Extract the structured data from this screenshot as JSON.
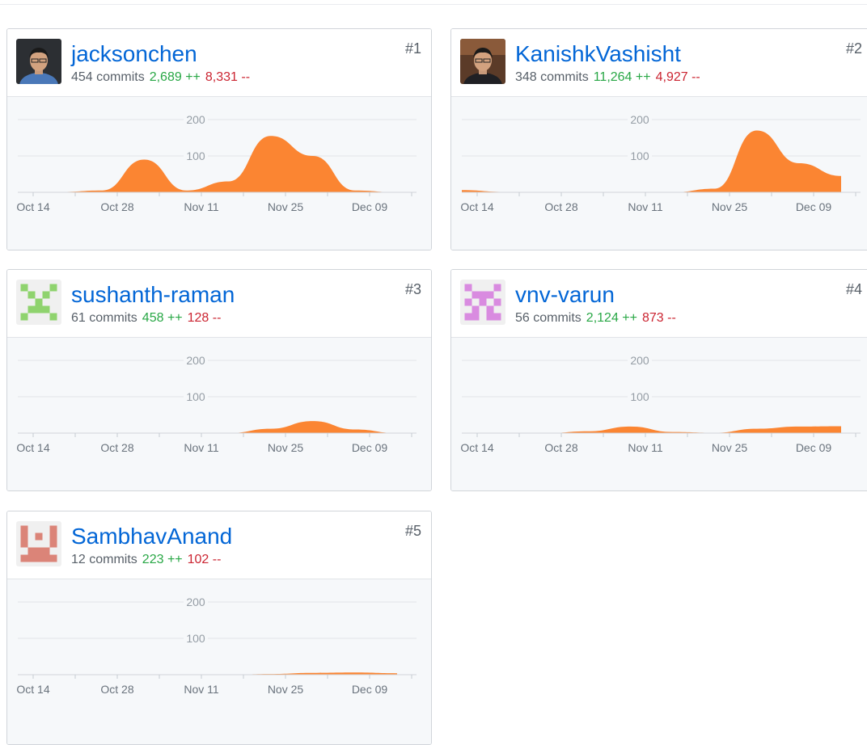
{
  "contributors": [
    {
      "username": "jacksonchen",
      "rank": "#1",
      "commits": "454 commits",
      "additions": "2,689 ++",
      "deletions": "8,331 --",
      "avatar": {
        "type": "photo",
        "icon": "person-photo"
      },
      "chart_data": {
        "type": "area",
        "x": [
          "Oct 14",
          "Oct 21",
          "Oct 28",
          "Nov 04",
          "Nov 11",
          "Nov 18",
          "Nov 25",
          "Dec 02",
          "Dec 09",
          "Dec 13"
        ],
        "values": [
          0,
          1,
          5,
          90,
          5,
          30,
          155,
          100,
          5,
          0
        ],
        "ylim": [
          0,
          200
        ],
        "y_ticks": [
          "100",
          "200"
        ],
        "tick_labels": [
          "Oct 14",
          "Oct 28",
          "Nov 11",
          "Nov 25",
          "Dec 09"
        ],
        "color": "#fb8532"
      }
    },
    {
      "username": "KanishkVashisht",
      "rank": "#2",
      "commits": "348 commits",
      "additions": "11,264 ++",
      "deletions": "4,927 --",
      "avatar": {
        "type": "photo",
        "icon": "person-photo"
      },
      "chart_data": {
        "type": "area",
        "x": [
          "Oct 14",
          "Oct 21",
          "Oct 28",
          "Nov 04",
          "Nov 11",
          "Nov 18",
          "Nov 25",
          "Dec 02",
          "Dec 09",
          "Dec 13"
        ],
        "values": [
          6,
          1,
          0,
          0,
          0,
          0,
          10,
          170,
          80,
          45
        ],
        "ylim": [
          0,
          200
        ],
        "y_ticks": [
          "100",
          "200"
        ],
        "tick_labels": [
          "Oct 14",
          "Oct 28",
          "Nov 11",
          "Nov 25",
          "Dec 09"
        ],
        "color": "#fb8532"
      }
    },
    {
      "username": "sushanth-raman",
      "rank": "#3",
      "commits": "61 commits",
      "additions": "458 ++",
      "deletions": "128 --",
      "avatar": {
        "type": "identicon",
        "color": "#8fd36e"
      },
      "chart_data": {
        "type": "area",
        "x": [
          "Oct 14",
          "Oct 21",
          "Oct 28",
          "Nov 04",
          "Nov 11",
          "Nov 18",
          "Nov 25",
          "Dec 02",
          "Dec 09",
          "Dec 13"
        ],
        "values": [
          0,
          0,
          0,
          0,
          0,
          0,
          12,
          33,
          10,
          0
        ],
        "ylim": [
          0,
          200
        ],
        "y_ticks": [
          "100",
          "200"
        ],
        "tick_labels": [
          "Oct 14",
          "Oct 28",
          "Nov 11",
          "Nov 25",
          "Dec 09"
        ],
        "color": "#fb8532"
      }
    },
    {
      "username": "vnv-varun",
      "rank": "#4",
      "commits": "56 commits",
      "additions": "2,124 ++",
      "deletions": "873 --",
      "avatar": {
        "type": "identicon",
        "color": "#d98be0"
      },
      "chart_data": {
        "type": "area",
        "x": [
          "Oct 14",
          "Oct 21",
          "Oct 28",
          "Nov 04",
          "Nov 11",
          "Nov 18",
          "Nov 25",
          "Dec 02",
          "Dec 09",
          "Dec 13"
        ],
        "values": [
          0,
          0,
          0,
          5,
          18,
          3,
          1,
          12,
          18,
          19
        ],
        "ylim": [
          0,
          200
        ],
        "y_ticks": [
          "100",
          "200"
        ],
        "tick_labels": [
          "Oct 14",
          "Oct 28",
          "Nov 11",
          "Nov 25",
          "Dec 09"
        ],
        "color": "#fb8532"
      }
    },
    {
      "username": "SambhavAnand",
      "rank": "#5",
      "commits": "12 commits",
      "additions": "223 ++",
      "deletions": "102 --",
      "avatar": {
        "type": "identicon",
        "color": "#db8478"
      },
      "chart_data": {
        "type": "area",
        "x": [
          "Oct 14",
          "Oct 21",
          "Oct 28",
          "Nov 04",
          "Nov 11",
          "Nov 18",
          "Nov 25",
          "Dec 02",
          "Dec 09",
          "Dec 13"
        ],
        "values": [
          0,
          0,
          0,
          0,
          1,
          0,
          2,
          5,
          6,
          4
        ],
        "ylim": [
          0,
          200
        ],
        "y_ticks": [
          "100",
          "200"
        ],
        "tick_labels": [
          "Oct 14",
          "Oct 28",
          "Nov 11",
          "Nov 25",
          "Dec 09"
        ],
        "color": "#fb8532"
      }
    }
  ]
}
